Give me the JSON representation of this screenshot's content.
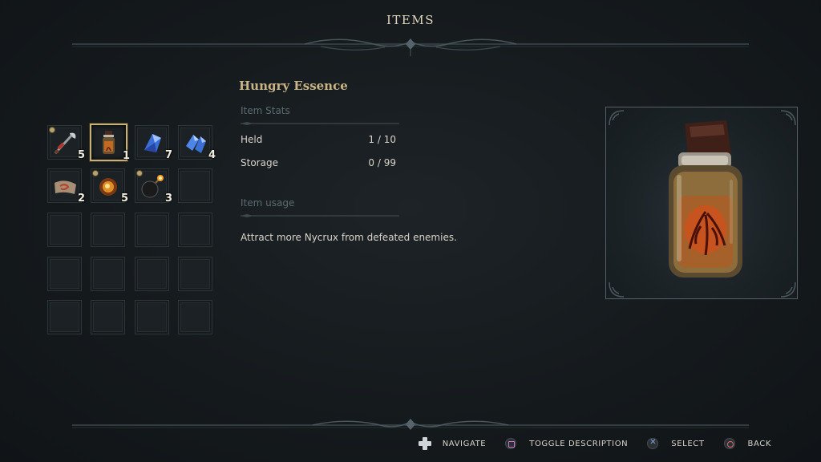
{
  "header": {
    "title": "ITEMS"
  },
  "inventory": {
    "slots": [
      {
        "icon": "hook-weapon-icon",
        "count": "5",
        "badge": true
      },
      {
        "icon": "hungry-essence-jar-icon",
        "count": "1",
        "badge": false,
        "selected": true
      },
      {
        "icon": "blue-crystal-shard-icon",
        "count": "7",
        "badge": false
      },
      {
        "icon": "blue-crystal-cluster-icon",
        "count": "4",
        "badge": false
      },
      {
        "icon": "scroll-sigil-icon",
        "count": "2",
        "badge": false
      },
      {
        "icon": "fire-orb-icon",
        "count": "5",
        "badge": true
      },
      {
        "icon": "bomb-icon",
        "count": "3",
        "badge": true
      }
    ]
  },
  "detail": {
    "name": "Hungry Essence",
    "stats_label": "Item Stats",
    "stats": [
      {
        "label": "Held",
        "value": "1 / 10"
      },
      {
        "label": "Storage",
        "value": "0 / 99"
      }
    ],
    "usage_label": "Item usage",
    "usage_text": "Attract more Nycrux from defeated enemies."
  },
  "preview": {
    "icon": "hungry-essence-jar-icon"
  },
  "footer": {
    "hints": [
      {
        "icon": "dpad-icon",
        "label": "NAVIGATE"
      },
      {
        "icon": "square-button-icon",
        "label": "TOGGLE DESCRIPTION"
      },
      {
        "icon": "cross-button-icon",
        "label": "SELECT"
      },
      {
        "icon": "circle-button-icon",
        "label": "BACK"
      }
    ]
  },
  "colors": {
    "accent_gold": "#c9b586",
    "selected_border": "#c7b27a",
    "square_glyph": "#c776c9",
    "cross_glyph": "#7ea6de",
    "circle_glyph": "#d36a6a"
  }
}
